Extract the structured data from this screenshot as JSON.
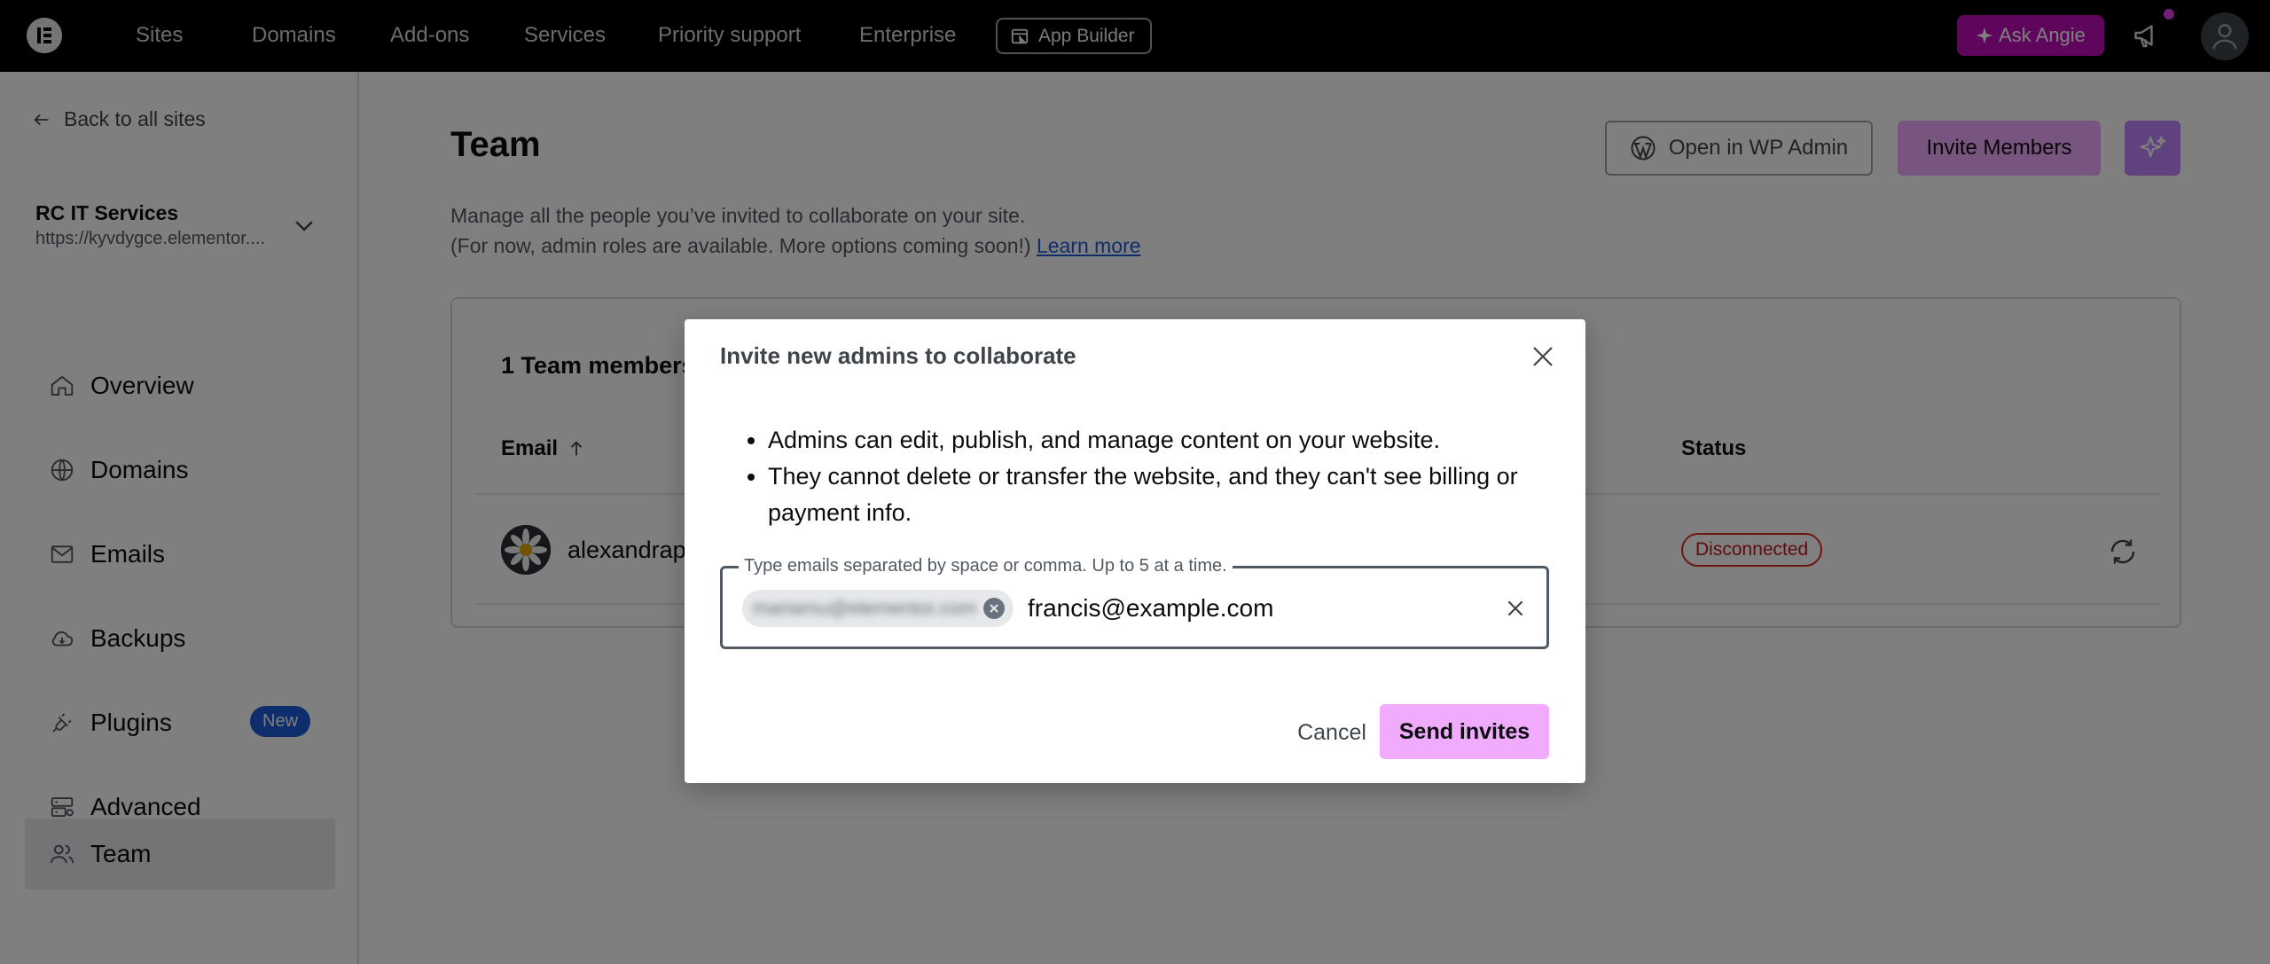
{
  "topbar": {
    "nav": [
      "Sites",
      "Domains",
      "Add-ons",
      "Services",
      "Priority support",
      "Enterprise"
    ],
    "app_builder": "App Builder",
    "ask_angie": "Ask Angie"
  },
  "sidebar": {
    "back": "Back to all sites",
    "site_name": "RC IT Services",
    "site_url": "https://kyvdygce.elementor....",
    "items": [
      {
        "label": "Overview",
        "icon": "home-icon"
      },
      {
        "label": "Domains",
        "icon": "www-icon"
      },
      {
        "label": "Emails",
        "icon": "mail-icon"
      },
      {
        "label": "Backups",
        "icon": "cloud-icon"
      },
      {
        "label": "Plugins",
        "icon": "plug-icon",
        "badge": "New"
      },
      {
        "label": "Advanced",
        "icon": "server-settings-icon"
      },
      {
        "label": "Team",
        "icon": "users-icon",
        "active": true
      }
    ]
  },
  "main": {
    "title": "Team",
    "desc_line1": "Manage all the people you’ve invited to collaborate on your site.",
    "desc_line2": "(For now, admin roles are available. More options coming soon!)",
    "learn_more": "Learn more",
    "open_wp": "Open in WP Admin",
    "invite_members": "Invite Members",
    "card_title": "1 Team members",
    "col_email": "Email",
    "col_status": "Status",
    "member_email": "alexandrap",
    "member_status": "Disconnected"
  },
  "modal": {
    "title": "Invite new admins to collaborate",
    "bullets": [
      "Admins can edit, publish, and manage content on your website.",
      "They cannot delete or transfer the website, and they can't see billing or payment info."
    ],
    "field_label": "Type emails separated by space or comma. Up to 5 at a time.",
    "chip_email": "mariamu@elementor.com",
    "input_value": "francis@example.com",
    "cancel": "Cancel",
    "send": "Send invites"
  },
  "colors": {
    "accent_pink": "#f0abfc",
    "ask_angie": "#c00bb9",
    "danger": "#dd2a2a",
    "badge_blue": "#1d5bd8"
  }
}
